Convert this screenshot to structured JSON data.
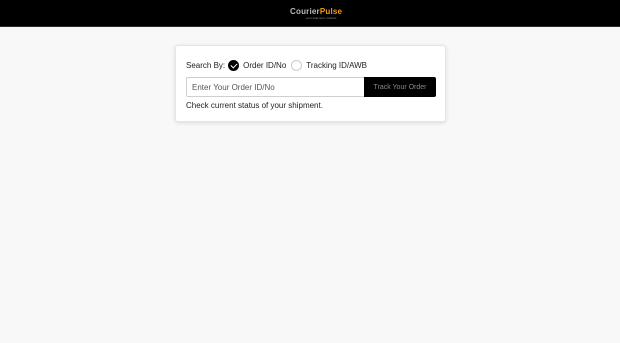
{
  "header": {
    "logo": {
      "text_a": "Courier",
      "text_b": "Pulse",
      "tagline": "your shipment, tracked"
    }
  },
  "form": {
    "search_by_label": "Search By:",
    "options": [
      {
        "label": "Order ID/No",
        "checked": true
      },
      {
        "label": "Tracking ID/AWB",
        "checked": false
      }
    ],
    "input_placeholder": "Enter Your Order ID/No",
    "input_value": "",
    "button_label": "Track Your Order",
    "help_text": "Check current status of your shipment."
  },
  "colors": {
    "header_bg": "#000000",
    "button_bg": "#000000",
    "logo_accent": "#f39c12"
  }
}
